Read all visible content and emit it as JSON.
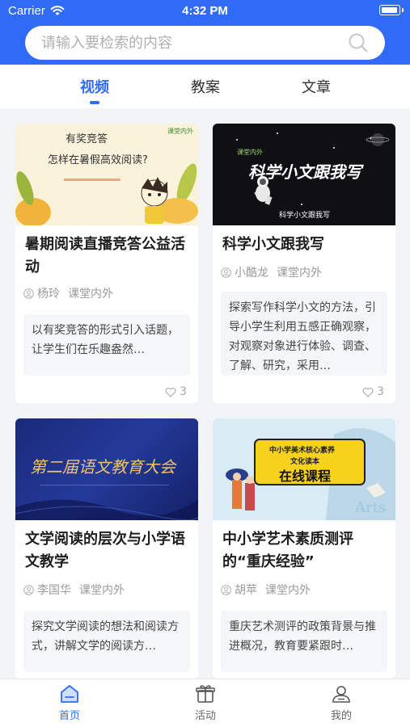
{
  "status": {
    "carrier": "Carrier",
    "time": "4:32 PM"
  },
  "search": {
    "placeholder": "请输入要检索的内容"
  },
  "tabs": [
    {
      "label": "视频",
      "active": true
    },
    {
      "label": "教案",
      "active": false
    },
    {
      "label": "文章",
      "active": false
    }
  ],
  "cards": [
    {
      "title": "暑期阅读直播竞答公益活动",
      "author": "杨玲",
      "source": "课堂内外",
      "description": "以有奖竞答的形式引入话题，让学生们在乐趣盎然…",
      "likes": "3",
      "thumb": {
        "line1": "有奖竞答",
        "line2": "怎样在暑假高效阅读?",
        "brand": "课堂内外"
      }
    },
    {
      "title": "科学小文跟我写",
      "author": "小酷龙",
      "source": "课堂内外",
      "description": "探索写作科学小文的方法，引导小学生利用五感正确观察，对观察对象进行体验、调查、了解、研究，采用…",
      "likes": "3",
      "thumb": {
        "line1": "科学小文跟我写",
        "line2": "科学小文跟我写",
        "brand": "课堂内外"
      }
    },
    {
      "title": "文学阅读的层次与小学语文教学",
      "author": "李国华",
      "source": "课堂内外",
      "description": "探究文学阅读的想法和阅读方式，讲解文学的阅读方…",
      "likes": "",
      "thumb": {
        "line1": "第二届语文教育大会"
      }
    },
    {
      "title": "中小学艺术素质测评的“重庆经验”",
      "author": "胡苹",
      "source": "课堂内外",
      "description": "重庆艺术测评的政策背景与推进概况，教育要紧跟时…",
      "likes": "",
      "thumb": {
        "line1": "中小学美术核心素养",
        "line2": "文化读本",
        "line3": "在线课程",
        "line4": "Arts"
      }
    }
  ],
  "bottom_nav": [
    {
      "label": "首页",
      "icon": "home-icon",
      "active": true
    },
    {
      "label": "活动",
      "icon": "gift-icon",
      "active": false
    },
    {
      "label": "我的",
      "icon": "user-icon",
      "active": false
    }
  ],
  "colors": {
    "accent": "#2f6bf5",
    "background": "#f3f4f7"
  }
}
